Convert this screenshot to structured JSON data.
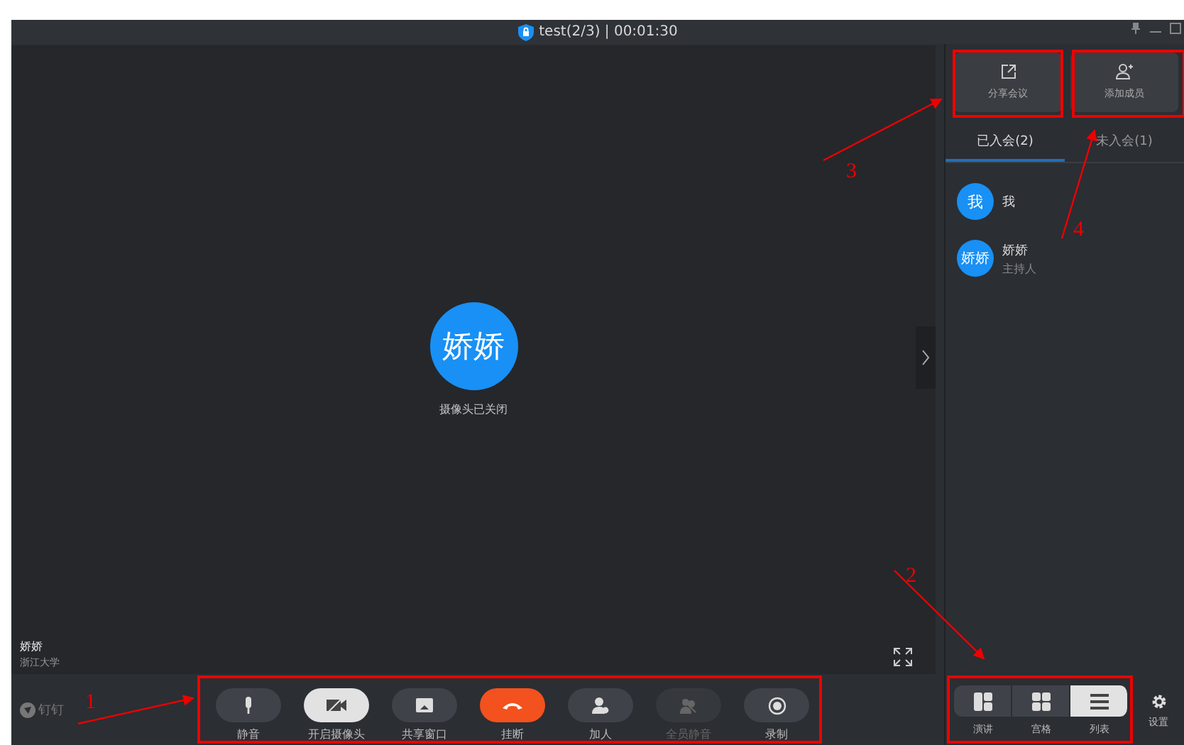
{
  "window": {
    "title": "test(2/3) | 00:01:30"
  },
  "video": {
    "avatar": "娇娇",
    "status": "摄像头已关闭",
    "name": "娇娇",
    "org": "浙江大学"
  },
  "sidebar": {
    "actions": [
      {
        "label": "分享会议",
        "kind": "share"
      },
      {
        "label": "添加成员",
        "kind": "add"
      }
    ],
    "tabs": [
      {
        "label": "已入会(2)",
        "selected": true
      },
      {
        "label": "未入会(1)",
        "selected": false
      }
    ],
    "members": [
      {
        "avatar": "我",
        "name": "我"
      },
      {
        "avatar": "娇娇",
        "name": "娇娇",
        "role": "主持人"
      }
    ]
  },
  "brand": "钉钉",
  "controls": [
    {
      "label": "静音",
      "kind": "mic",
      "disabled": false
    },
    {
      "label": "开启摄像头",
      "kind": "camera",
      "disabled": false
    },
    {
      "label": "共享窗口",
      "kind": "share",
      "disabled": false
    },
    {
      "label": "挂断",
      "kind": "hangup",
      "disabled": false
    },
    {
      "label": "加人",
      "kind": "adduser",
      "disabled": false
    },
    {
      "label": "全员静音",
      "kind": "muteall",
      "disabled": true
    },
    {
      "label": "录制",
      "kind": "record",
      "disabled": false
    }
  ],
  "layouts": [
    {
      "label": "演讲",
      "kind": "speaker",
      "selected": false
    },
    {
      "label": "宫格",
      "kind": "grid",
      "selected": false
    },
    {
      "label": "列表",
      "kind": "list",
      "selected": true
    }
  ],
  "settings": "设置",
  "annotations": [
    {
      "number": "1"
    },
    {
      "number": "2"
    },
    {
      "number": "3"
    },
    {
      "number": "4"
    }
  ]
}
